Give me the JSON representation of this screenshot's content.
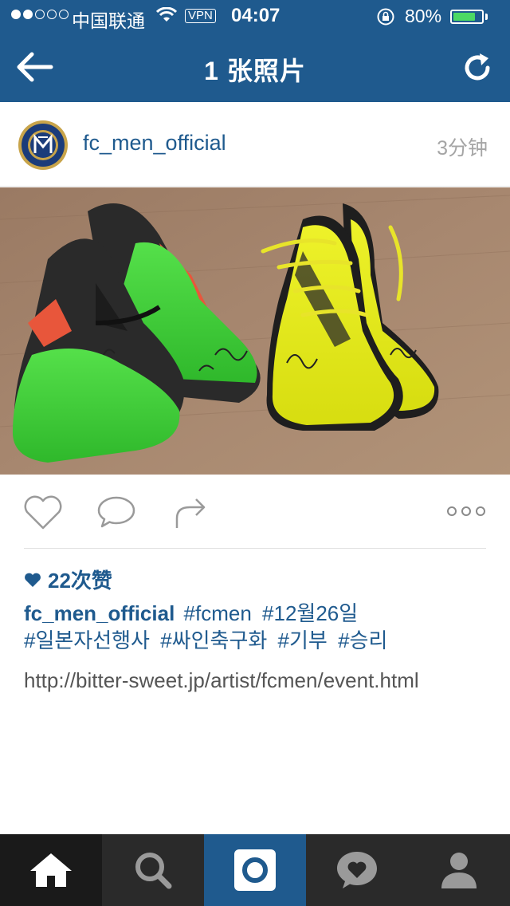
{
  "status_bar": {
    "carrier": "中国联通",
    "vpn": "VPN",
    "time": "04:07",
    "battery_percent": "80%",
    "battery_level": 0.8,
    "signal_bars": 2
  },
  "nav": {
    "title": "1 张照片",
    "back_icon": "back-arrow-icon",
    "refresh_icon": "refresh-icon"
  },
  "post": {
    "username": "fc_men_official",
    "time_ago": "3分钟",
    "photo_alt": "Two signed football boots",
    "likes": "22次赞",
    "caption_user": "fc_men_official",
    "hashtags": [
      "#fcmen",
      "#12월26일",
      "#일본자선행사",
      "#싸인축구화",
      "#기부",
      "#승리"
    ],
    "link": "http://bitter-sweet.jp/artist/fcmen/event.html"
  },
  "tabs": [
    {
      "name": "home",
      "icon": "home-icon"
    },
    {
      "name": "explore",
      "icon": "search-icon"
    },
    {
      "name": "camera",
      "icon": "camera-icon"
    },
    {
      "name": "activity",
      "icon": "heart-bubble-icon"
    },
    {
      "name": "profile",
      "icon": "profile-icon"
    }
  ],
  "colors": {
    "brand_blue": "#1f5a8e",
    "tabbar_bg": "#2a2a2a",
    "battery_green": "#4cd964"
  }
}
